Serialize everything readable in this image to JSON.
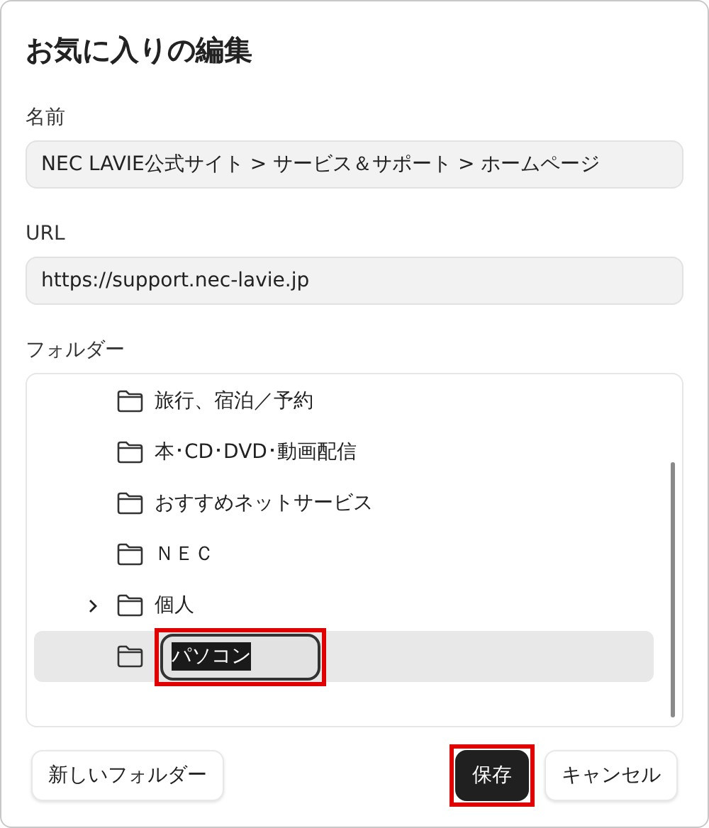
{
  "dialog": {
    "title": "お気に入りの編集"
  },
  "name_field": {
    "label": "名前",
    "value": "NEC LAVIE公式サイト > サービス＆サポート > ホームページ"
  },
  "url_field": {
    "label": "URL",
    "value": "https://support.nec-lavie.jp"
  },
  "folder_tree": {
    "label": "フォルダー",
    "items": [
      {
        "kind": "folder",
        "label": "旅行、宿泊／予約",
        "has_children": false,
        "selected": false
      },
      {
        "kind": "folder",
        "label": "本･CD･DVD･動画配信",
        "has_children": false,
        "selected": false
      },
      {
        "kind": "folder",
        "label": "おすすめネットサービス",
        "has_children": false,
        "selected": false
      },
      {
        "kind": "folder",
        "label": "ＮＥＣ",
        "has_children": false,
        "selected": false
      },
      {
        "kind": "folder",
        "label": "個人",
        "has_children": true,
        "expanded": false,
        "selected": false
      },
      {
        "kind": "rename",
        "label": "パソコン",
        "has_children": false,
        "selected": true,
        "text_selected": true,
        "highlighted": true
      }
    ]
  },
  "buttons": [
    {
      "kind": "secondary",
      "label": "新しいフォルダー",
      "highlighted": false
    },
    {
      "kind": "spacer"
    },
    {
      "kind": "primary",
      "label": "保存",
      "highlighted": true
    },
    {
      "kind": "secondary",
      "label": "キャンセル",
      "highlighted": false
    }
  ]
}
